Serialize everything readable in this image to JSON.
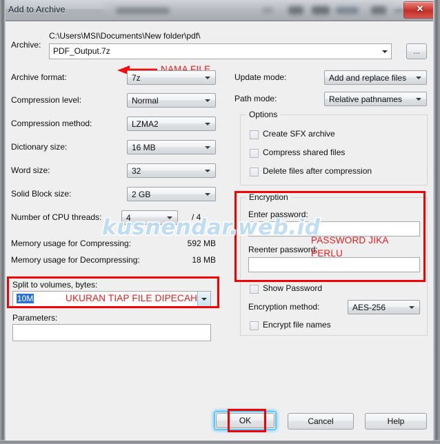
{
  "window": {
    "title": "Add to Archive",
    "close_label": "✕"
  },
  "archive": {
    "label": "Archive:",
    "path": "C:\\Users\\MSI\\Documents\\New folder\\pdf\\",
    "filename": "PDF_Output.7z",
    "browse_label": "...",
    "annotation": "NAMA FILE"
  },
  "left": {
    "archive_format": {
      "label": "Archive format:",
      "value": "7z"
    },
    "compression_level": {
      "label": "Compression level:",
      "value": "Normal"
    },
    "compression_method": {
      "label": "Compression method:",
      "value": "LZMA2"
    },
    "dictionary_size": {
      "label": "Dictionary size:",
      "value": "16 MB"
    },
    "word_size": {
      "label": "Word size:",
      "value": "32"
    },
    "solid_block_size": {
      "label": "Solid Block size:",
      "value": "2 GB"
    },
    "cpu_threads": {
      "label": "Number of CPU threads:",
      "value": "4",
      "total": "/ 4"
    },
    "memory_compress": {
      "label": "Memory usage for Compressing:",
      "value": "592 MB"
    },
    "memory_decompress": {
      "label": "Memory usage for Decompressing:",
      "value": "18 MB"
    },
    "split_volumes": {
      "label": "Split to volumes, bytes:",
      "value": "10M",
      "annotation": "UKURAN TIAP FILE DIPECAH"
    },
    "parameters": {
      "label": "Parameters:",
      "value": ""
    }
  },
  "right": {
    "update_mode": {
      "label": "Update mode:",
      "value": "Add and replace files"
    },
    "path_mode": {
      "label": "Path mode:",
      "value": "Relative pathnames"
    },
    "options": {
      "title": "Options",
      "items": [
        {
          "label": "Create SFX archive",
          "checked": false
        },
        {
          "label": "Compress shared files",
          "checked": false
        },
        {
          "label": "Delete files after compression",
          "checked": false
        }
      ]
    },
    "encryption": {
      "title": "Encryption",
      "enter_password_label": "Enter password:",
      "enter_password_value": "",
      "reenter_password_label": "Reenter password:",
      "reenter_password_value": "",
      "annotation_line1": "PASSWORD JIKA",
      "annotation_line2": "PERLU",
      "show_password": {
        "label": "Show Password",
        "checked": false
      },
      "method": {
        "label": "Encryption method:",
        "value": "AES-256"
      },
      "encrypt_file_names": {
        "label": "Encrypt file names",
        "checked": false
      }
    }
  },
  "footer": {
    "ok": "OK",
    "cancel": "Cancel",
    "help": "Help"
  },
  "watermark": "kusnendar.web.id",
  "colors": {
    "annotation_red": "#ec1c1c",
    "box_red": "#f40000",
    "selection_blue": "#2a6fd4",
    "focus_blue": "#5fc8f5"
  }
}
